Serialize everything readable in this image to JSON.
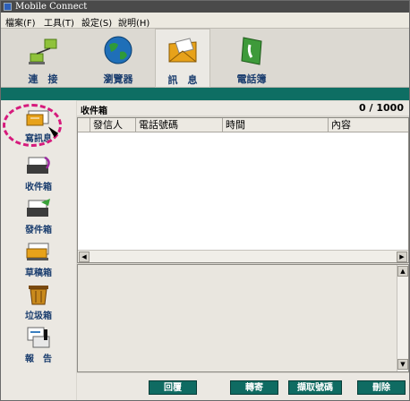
{
  "window": {
    "title": "Mobile Connect"
  },
  "menu": [
    "檔案(F)",
    "工具(T)",
    "設定(S)",
    "說明(H)"
  ],
  "toolbar": {
    "items": [
      {
        "label": "連　接",
        "icon": "connect-icon"
      },
      {
        "label": "瀏覽器",
        "icon": "globe-icon"
      },
      {
        "label": "訊　息",
        "icon": "envelope-icon",
        "selected": true
      },
      {
        "label": "電話簿",
        "icon": "phonebook-icon"
      }
    ]
  },
  "sidebar": {
    "items": [
      {
        "label": "寫訊息",
        "icon": "compose-icon",
        "highlighted": true
      },
      {
        "label": "收件箱",
        "icon": "inbox-icon"
      },
      {
        "label": "發件箱",
        "icon": "outbox-icon"
      },
      {
        "label": "草稿箱",
        "icon": "drafts-icon"
      },
      {
        "label": "垃圾箱",
        "icon": "trash-icon"
      },
      {
        "label": "報　告",
        "icon": "report-icon"
      }
    ]
  },
  "inbox": {
    "title": "收件箱",
    "count": "0 / 1000",
    "columns": [
      "發信人",
      "電話號碼",
      "時間",
      "內容"
    ]
  },
  "actions": [
    "回覆",
    "轉寄",
    "擷取號碼",
    "刪除"
  ],
  "colors": {
    "accent": "#0e6e63",
    "highlight": "#d61a7c",
    "label": "#1a3d6e"
  }
}
